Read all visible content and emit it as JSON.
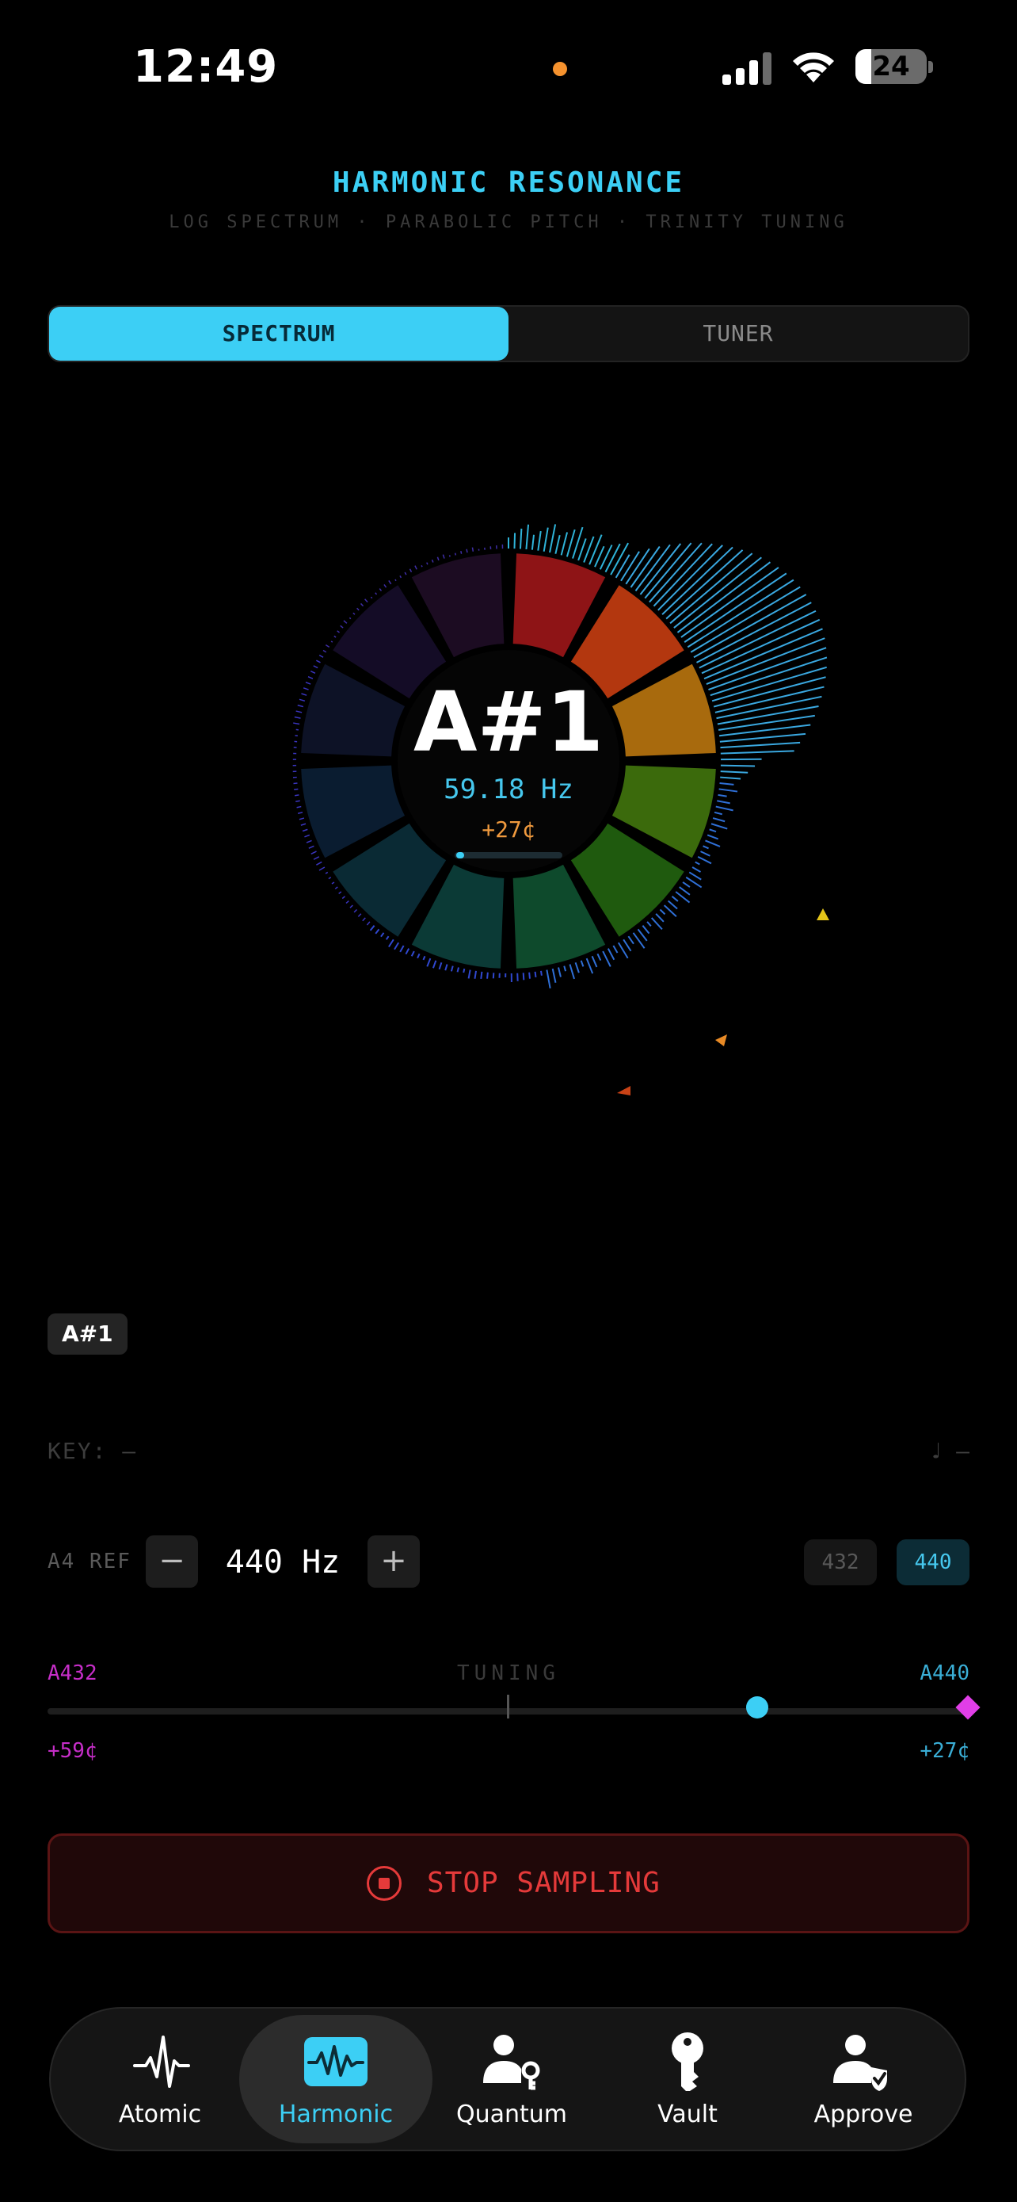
{
  "status_bar": {
    "time": "12:49",
    "battery": "24"
  },
  "header": {
    "title": "HARMONIC RESONANCE",
    "subtitle": "LOG SPECTRUM · PARABOLIC PITCH · TRINITY TUNING"
  },
  "segment": {
    "spectrum_label": "SPECTRUM",
    "tuner_label": "TUNER",
    "selected": "SPECTRUM"
  },
  "wheel": {
    "note": "A#1",
    "frequency": "59.18 Hz",
    "cents": "+27¢",
    "segment_colors": [
      "#8e1416",
      "#b3370f",
      "#a86a0d",
      "#3b6a0c",
      "#1f5a0e",
      "#0e4a2c",
      "#0b3a36",
      "#0a2a34",
      "#0a1c30",
      "#0d1226",
      "#140c26",
      "#1c0c22"
    ]
  },
  "note_chip": "A#1",
  "key": {
    "label": "KEY: —",
    "right": "♩ —"
  },
  "reference": {
    "label": "A4 REF",
    "minus": "−",
    "plus": "+",
    "value": "440 Hz",
    "presets": [
      "432",
      "440"
    ],
    "selected_preset": "440"
  },
  "tuning": {
    "left_label": "A432",
    "center_label": "TUNING",
    "right_label": "A440",
    "left_cents": "+59¢",
    "right_cents": "+27¢",
    "position": 0.77
  },
  "stop_button": {
    "label": "STOP SAMPLING"
  },
  "tabs": [
    {
      "label": "Atomic",
      "icon": "pulse-icon"
    },
    {
      "label": "Harmonic",
      "icon": "waveform-icon",
      "active": true
    },
    {
      "label": "Quantum",
      "icon": "user-key-icon"
    },
    {
      "label": "Vault",
      "icon": "key-icon"
    },
    {
      "label": "Approve",
      "icon": "user-check-icon"
    }
  ],
  "colors": {
    "accent": "#3ccff5",
    "stop": "#e53a3a",
    "magenta": "#c62ec8",
    "amber": "#f09a3e"
  }
}
